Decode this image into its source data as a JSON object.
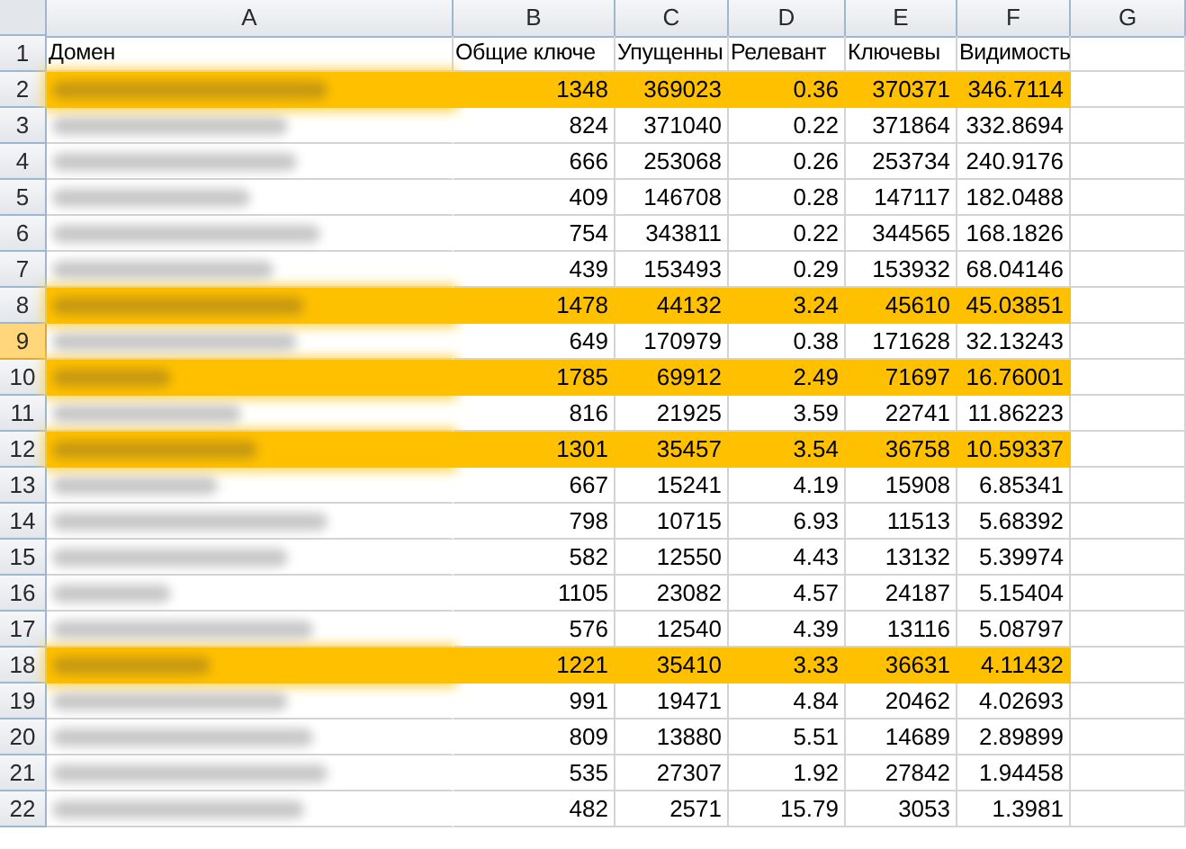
{
  "column_headers": [
    {
      "label": "A"
    },
    {
      "label": "B"
    },
    {
      "label": "C"
    },
    {
      "label": "D"
    },
    {
      "label": "E"
    },
    {
      "label": "F"
    },
    {
      "label": "G"
    }
  ],
  "header_row": {
    "number": "1",
    "selected": false,
    "cells": [
      "Домен",
      "Общие ключе",
      "Упущенны",
      "Релевант",
      "Ключевы",
      "Видимость"
    ]
  },
  "rows": [
    {
      "number": "2",
      "selected": false,
      "highlighted": true,
      "cells": [
        "1348",
        "369023",
        "0.36",
        "370371",
        "346.7114"
      ]
    },
    {
      "number": "3",
      "selected": false,
      "highlighted": false,
      "cells": [
        "824",
        "371040",
        "0.22",
        "371864",
        "332.8694"
      ]
    },
    {
      "number": "4",
      "selected": false,
      "highlighted": false,
      "cells": [
        "666",
        "253068",
        "0.26",
        "253734",
        "240.9176"
      ]
    },
    {
      "number": "5",
      "selected": false,
      "highlighted": false,
      "cells": [
        "409",
        "146708",
        "0.28",
        "147117",
        "182.0488"
      ]
    },
    {
      "number": "6",
      "selected": false,
      "highlighted": false,
      "cells": [
        "754",
        "343811",
        "0.22",
        "344565",
        "168.1826"
      ]
    },
    {
      "number": "7",
      "selected": false,
      "highlighted": false,
      "cells": [
        "439",
        "153493",
        "0.29",
        "153932",
        "68.04146"
      ]
    },
    {
      "number": "8",
      "selected": false,
      "highlighted": true,
      "cells": [
        "1478",
        "44132",
        "3.24",
        "45610",
        "45.03851"
      ]
    },
    {
      "number": "9",
      "selected": true,
      "highlighted": false,
      "cells": [
        "649",
        "170979",
        "0.38",
        "171628",
        "32.13243"
      ]
    },
    {
      "number": "10",
      "selected": false,
      "highlighted": true,
      "cells": [
        "1785",
        "69912",
        "2.49",
        "71697",
        "16.76001"
      ]
    },
    {
      "number": "11",
      "selected": false,
      "highlighted": false,
      "cells": [
        "816",
        "21925",
        "3.59",
        "22741",
        "11.86223"
      ]
    },
    {
      "number": "12",
      "selected": false,
      "highlighted": true,
      "cells": [
        "1301",
        "35457",
        "3.54",
        "36758",
        "10.59337"
      ]
    },
    {
      "number": "13",
      "selected": false,
      "highlighted": false,
      "cells": [
        "667",
        "15241",
        "4.19",
        "15908",
        "6.85341"
      ]
    },
    {
      "number": "14",
      "selected": false,
      "highlighted": false,
      "cells": [
        "798",
        "10715",
        "6.93",
        "11513",
        "5.68392"
      ]
    },
    {
      "number": "15",
      "selected": false,
      "highlighted": false,
      "cells": [
        "582",
        "12550",
        "4.43",
        "13132",
        "5.39974"
      ]
    },
    {
      "number": "16",
      "selected": false,
      "highlighted": false,
      "cells": [
        "1105",
        "23082",
        "4.57",
        "24187",
        "5.15404"
      ]
    },
    {
      "number": "17",
      "selected": false,
      "highlighted": false,
      "cells": [
        "576",
        "12540",
        "4.39",
        "13116",
        "5.08797"
      ]
    },
    {
      "number": "18",
      "selected": false,
      "highlighted": true,
      "cells": [
        "1221",
        "35410",
        "3.33",
        "36631",
        "4.11432"
      ]
    },
    {
      "number": "19",
      "selected": false,
      "highlighted": false,
      "cells": [
        "991",
        "19471",
        "4.84",
        "20462",
        "4.02693"
      ]
    },
    {
      "number": "20",
      "selected": false,
      "highlighted": false,
      "cells": [
        "809",
        "13880",
        "5.51",
        "14689",
        "2.89899"
      ]
    },
    {
      "number": "21",
      "selected": false,
      "highlighted": false,
      "cells": [
        "535",
        "27307",
        "1.92",
        "27842",
        "1.94458"
      ]
    },
    {
      "number": "22",
      "selected": false,
      "highlighted": false,
      "cells": [
        "482",
        "2571",
        "15.79",
        "3053",
        "1.3981"
      ]
    }
  ]
}
